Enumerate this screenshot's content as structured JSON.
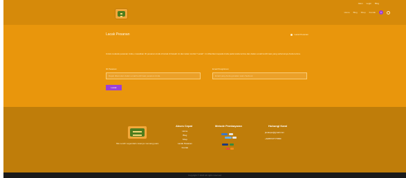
{
  "top_menu": [
    "Akun",
    "Login",
    "Blog"
  ],
  "nav": {
    "items": [
      "Home",
      "Blog",
      "Shop",
      "Kontak"
    ],
    "cart_count": "0"
  },
  "page": {
    "title": "Lacak Pesanan",
    "breadcrumb": "Lacak Pesanan"
  },
  "form": {
    "intro": "Untuk melacak pesanan Anda, masukkan ID pesanan Anda di kotak di bawah ini dan tekan tombol \"Lacak\". Ini diberikan kepada Anda pada tanda terima dan dalam email konfirmasi yang seharusnya Anda terima.",
    "order_id_label": "ID Pesanan",
    "order_id_placeholder": "Dapat ditemukan dalam email konfirmasi pesanan Anda.",
    "email_label": "Email Pengiriman",
    "email_placeholder": "Email yang Anda gunakan saat checkout.",
    "submit_label": "Lacak"
  },
  "footer": {
    "tagline": "Mie Lendir Legendaris rasanya memang juara",
    "quick_access": {
      "title": "Akses Cepat",
      "links": [
        "Home",
        "Blog",
        "Shop",
        "Lacak Pesanan",
        "Kontak"
      ]
    },
    "payment": {
      "title": "Metode Pembayaran"
    },
    "contact": {
      "title": "Hubungi Kami",
      "email": "javatepe@gmail.com",
      "phone": "+6285737777880"
    },
    "copyright": "Copyright © 2023 All rights reserved"
  },
  "colors": {
    "page_bg": "#e9960c",
    "header_bg": "#d68a0a",
    "footer_bg": "#bf7d0a",
    "accent_purple": "#9b40d8",
    "bottom_bar": "#1a1a1a"
  }
}
